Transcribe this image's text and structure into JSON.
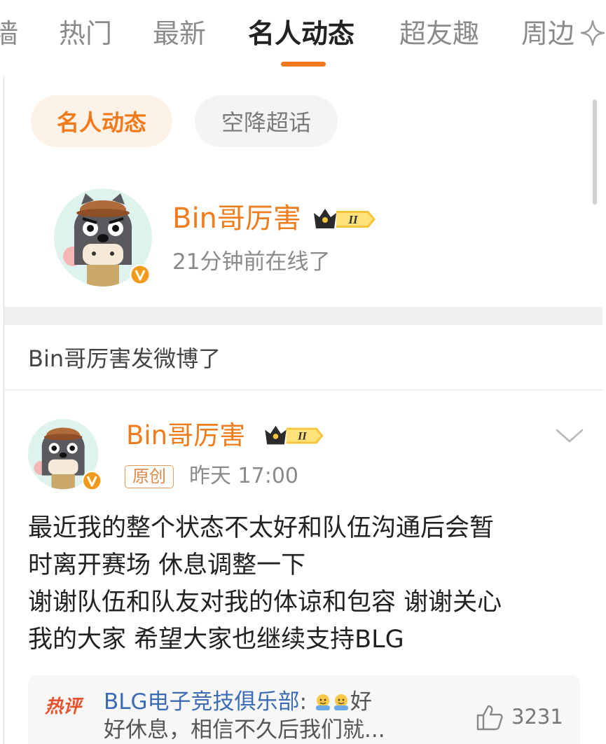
{
  "tabs": [
    {
      "label": "墙",
      "active": false
    },
    {
      "label": "热门",
      "active": false
    },
    {
      "label": "最新",
      "active": false
    },
    {
      "label": "名人动态",
      "active": true
    },
    {
      "label": "超友趣",
      "active": false
    },
    {
      "label": "周边",
      "active": false
    }
  ],
  "chips": {
    "active": "名人动态",
    "inactive": "空降超话"
  },
  "celebrity": {
    "name": "Bin哥厉害",
    "status": "21分钟前在线了",
    "level_badge": "II"
  },
  "notice": "Bin哥厉害发微博了",
  "post": {
    "author": "Bin哥厉害",
    "level_badge": "II",
    "tag": "原创",
    "time": "昨天 17:00",
    "lines": [
      "最近我的整个状态不太好和队伍沟通后会暂",
      "时离开赛场 休息调整一下",
      "谢谢队伍和队友对我的体谅和包容 谢谢关心",
      "我的大家 希望大家也继续支持BLG"
    ]
  },
  "hot_comment": {
    "label": "热评",
    "author": "BLG电子竞技俱乐部",
    "separator": ":",
    "text_line1": "好",
    "text_line2": "好休息，相信不久后我们就...",
    "likes": "3231"
  },
  "colors": {
    "accent": "#f27a1a",
    "name": "#f07c1c",
    "hot": "#e8512c",
    "link": "#3b6cb5"
  }
}
